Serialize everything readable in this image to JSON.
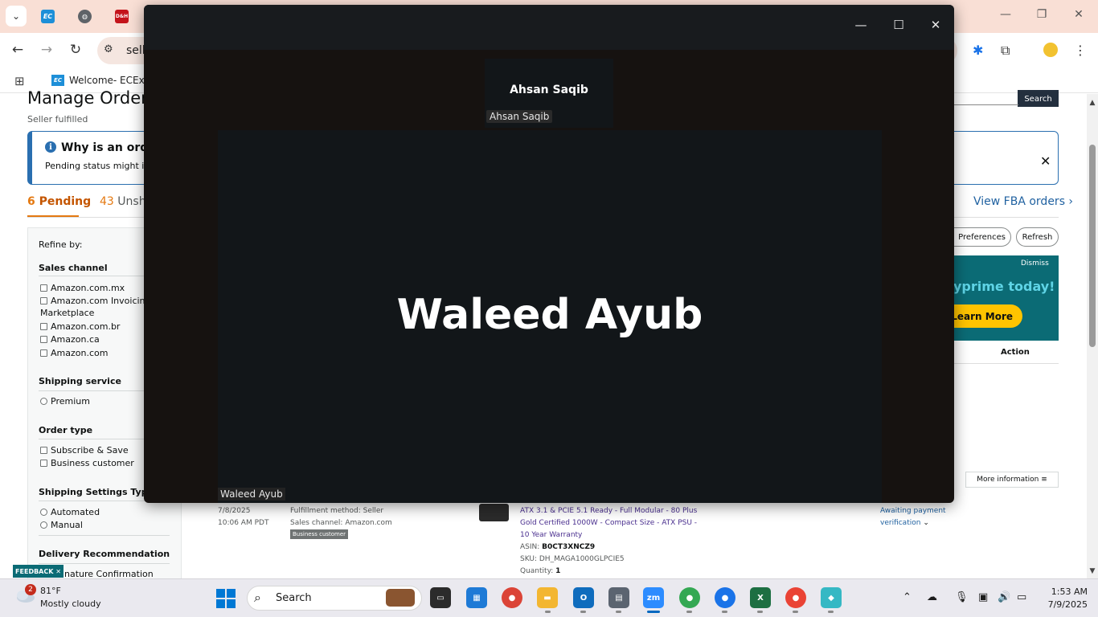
{
  "browser": {
    "bookmark_label": "Welcome- ECExpr",
    "omnibox_text": "selle",
    "tab_favicons": [
      "EC",
      "D&H"
    ]
  },
  "amazon": {
    "title": "Manage Orders",
    "subtitle": "Seller fulfilled",
    "alert_title": "Why is an order",
    "alert_body": "Pending status might indi",
    "tabs": {
      "pending_count": "6",
      "pending_label": "Pending",
      "unshipped_count": "43",
      "unshipped_label": "Unshi"
    },
    "view_fba": "View FBA orders ›",
    "search_button": "Search",
    "preferences_button": "Preferences",
    "refresh_button": "Refresh",
    "banner": {
      "dismiss": "Dismiss",
      "headline": "yprime today!",
      "cta": "Learn More"
    },
    "table_action_header": "Action",
    "more_info_button": "More information ≡",
    "refine": {
      "label": "Refine by:",
      "sales_channel": {
        "title": "Sales channel",
        "options": [
          "Amazon.com.mx",
          "Amazon.com Invoicing S",
          "Marketplace",
          "Amazon.com.br",
          "Amazon.ca",
          "Amazon.com"
        ]
      },
      "shipping_service": {
        "title": "Shipping service",
        "options": [
          "Premium"
        ]
      },
      "order_type": {
        "title": "Order type",
        "options": [
          "Subscribe & Save",
          "Business customer"
        ]
      },
      "shipping_settings": {
        "title": "Shipping Settings Type",
        "options": [
          "Automated",
          "Manual"
        ]
      },
      "delivery_rec": {
        "title": "Delivery Recommendation",
        "option": "nature Confirmation"
      }
    },
    "order": {
      "date": "7/8/2025",
      "time": "10:06 AM PDT",
      "fulfillment": "Fulfillment method: Seller",
      "channel": "Sales channel: Amazon.com",
      "badge": "Business customer",
      "product_title": "ATX 3.1 & PCIE 5.1 Ready - Full Modular - 80 Plus Gold Certified 1000W - Compact Size - ATX PSU - 10 Year Warranty",
      "asin_label": "ASIN:",
      "asin": "B0CT3XNCZ9",
      "sku_label": "SKU:",
      "sku": "DH_MAGA1000GLPCIE5",
      "qty_label": "Quantity:",
      "qty": "1",
      "status_line1": "Awaiting payment",
      "status_line2": "verification"
    },
    "feedback": "FEEDBACK ✕"
  },
  "zoom": {
    "top_participant_name": "Ahsan Saqib",
    "top_participant_label": "Ahsan Saqib",
    "main_participant_name": "Waleed Ayub",
    "main_participant_label": "Waleed Ayub"
  },
  "taskbar": {
    "weather_badge": "2",
    "weather_temp": "81°F",
    "weather_desc": "Mostly cloudy",
    "search_placeholder": "Search",
    "time": "1:53 AM",
    "date": "7/9/2025",
    "apps": [
      "task-view",
      "microsoft-store",
      "chrome",
      "file-explorer",
      "outlook",
      "calculator",
      "zoom",
      "chrome-profile-1",
      "chrome-profile-2",
      "excel",
      "chrome-profile-3",
      "app"
    ]
  }
}
